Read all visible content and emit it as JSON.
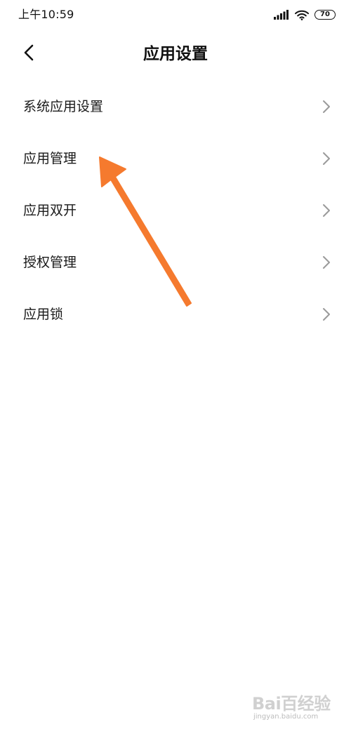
{
  "status_bar": {
    "time": "上午10:59",
    "battery_level": "70",
    "icons": [
      "signal-icon",
      "wifi-icon",
      "battery-icon"
    ]
  },
  "nav": {
    "back_icon": "chevron-left-icon",
    "title": "应用设置"
  },
  "settings": {
    "items": [
      {
        "label": "系统应用设置"
      },
      {
        "label": "应用管理"
      },
      {
        "label": "应用双开"
      },
      {
        "label": "授权管理"
      },
      {
        "label": "应用锁"
      }
    ]
  },
  "annotation": {
    "icon": "arrow-icon",
    "color": "#f57a2e"
  },
  "watermark": {
    "logo": "Bai百经验",
    "url": "jingyan.baidu.com"
  },
  "colors": {
    "text": "#1a1a1a",
    "chevron": "#9a9a9a",
    "background": "#ffffff"
  }
}
